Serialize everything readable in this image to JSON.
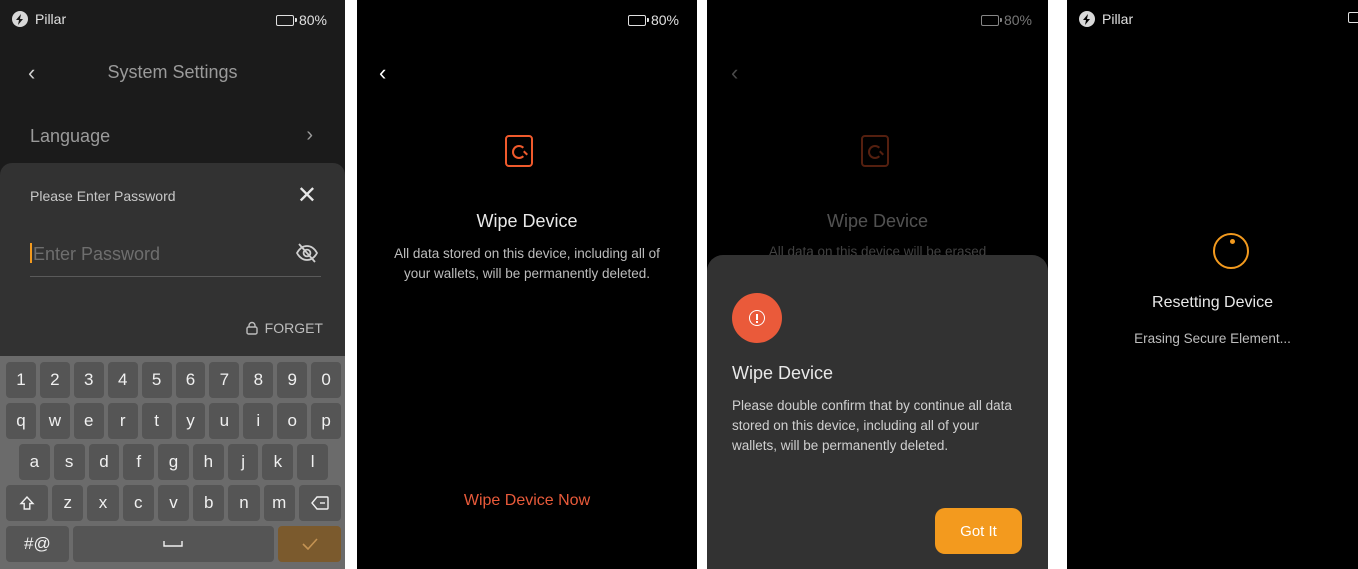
{
  "status": {
    "brand": "Pillar",
    "battery": "80%",
    "battery_level": 0.8
  },
  "screen1": {
    "header_title": "System Settings",
    "menu_item_language": "Language",
    "password_sheet": {
      "title": "Please Enter Password",
      "placeholder": "Enter Password",
      "forget_label": "FORGET"
    },
    "keyboard": {
      "row1": [
        "1",
        "2",
        "3",
        "4",
        "5",
        "6",
        "7",
        "8",
        "9",
        "0"
      ],
      "row2": [
        "q",
        "w",
        "e",
        "r",
        "t",
        "y",
        "u",
        "i",
        "o",
        "p"
      ],
      "row3": [
        "a",
        "s",
        "d",
        "f",
        "g",
        "h",
        "j",
        "k",
        "l"
      ],
      "row4": [
        "z",
        "x",
        "c",
        "v",
        "b",
        "n",
        "m"
      ],
      "sym_label": "#@"
    }
  },
  "screen2": {
    "title": "Wipe Device",
    "description": "All data stored on this device, including all of your wallets, will be permanently deleted.",
    "action_label": "Wipe Device Now"
  },
  "screen3": {
    "bg_title": "Wipe Device",
    "bg_description": "All data on this device will be erased",
    "dialog_title": "Wipe Device",
    "dialog_body": "Please double confirm that by continue all data stored on this device, including all of your wallets, will be permanently deleted.",
    "confirm_label": "Got It"
  },
  "screen4": {
    "title": "Resetting Device",
    "subtitle": "Erasing Secure Element..."
  },
  "colors": {
    "accent": "#f39a1e",
    "danger": "#e85a3a",
    "background": "#000000",
    "sheet": "#323232"
  }
}
